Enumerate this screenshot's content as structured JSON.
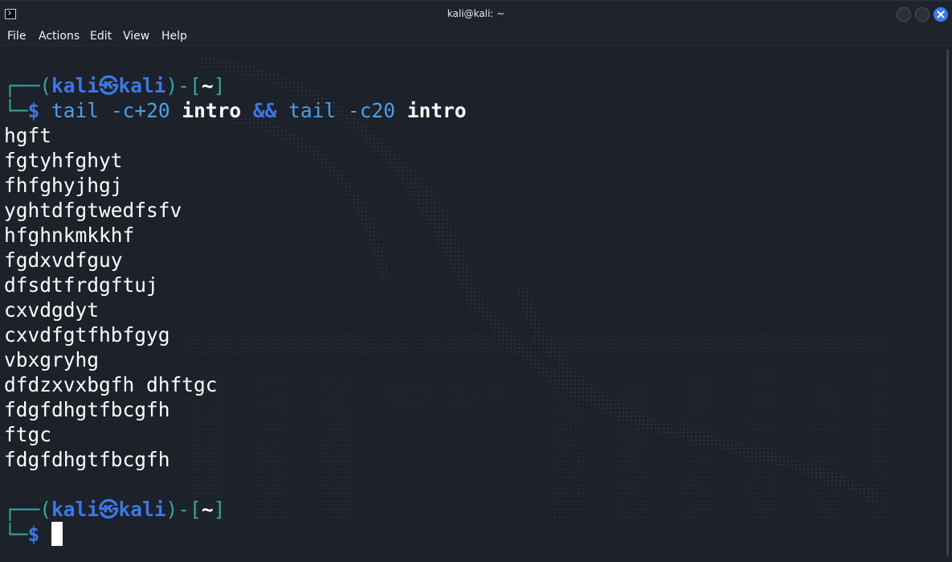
{
  "window": {
    "title": "kali@kali: ~",
    "icon": "terminal-icon"
  },
  "menu": [
    "File",
    "Actions",
    "Edit",
    "View",
    "Help"
  ],
  "prompt": {
    "corner_top": "┌──(",
    "user": "kali",
    "at": "㉿",
    "host": "kali",
    "mid": ")-[",
    "dir": "~",
    "end": "]",
    "corner_bottom": "└─",
    "symbol": "$"
  },
  "command": {
    "cmd1": "tail",
    "arg1": "-c+20",
    "file1": "intro",
    "op": "&&",
    "cmd2": "tail",
    "arg2": "-c20",
    "file2": "intro"
  },
  "output": [
    "hgft",
    "fgtyhfghyt",
    "fhfghyjhgj",
    "yghtdfgtwedfsfv",
    "hfghnkmkkhf",
    "fgdxvdfguy",
    "dfsdtfrdgftuj",
    "cxvdgdyt",
    "cxvdfgtfhbfgyg",
    "vbxgryhg",
    "dfdzxvxbgfh dhftgc",
    "fdgfdhgtfbcgfh",
    "ftgc",
    "fdgfdhgtfbcgfh"
  ],
  "colors": {
    "background": "#1d2129",
    "prompt_frame": "#31a7a0",
    "prompt_user": "#3c78e4",
    "command": "#4aa1e6",
    "close_button": "#3a7bf0"
  }
}
